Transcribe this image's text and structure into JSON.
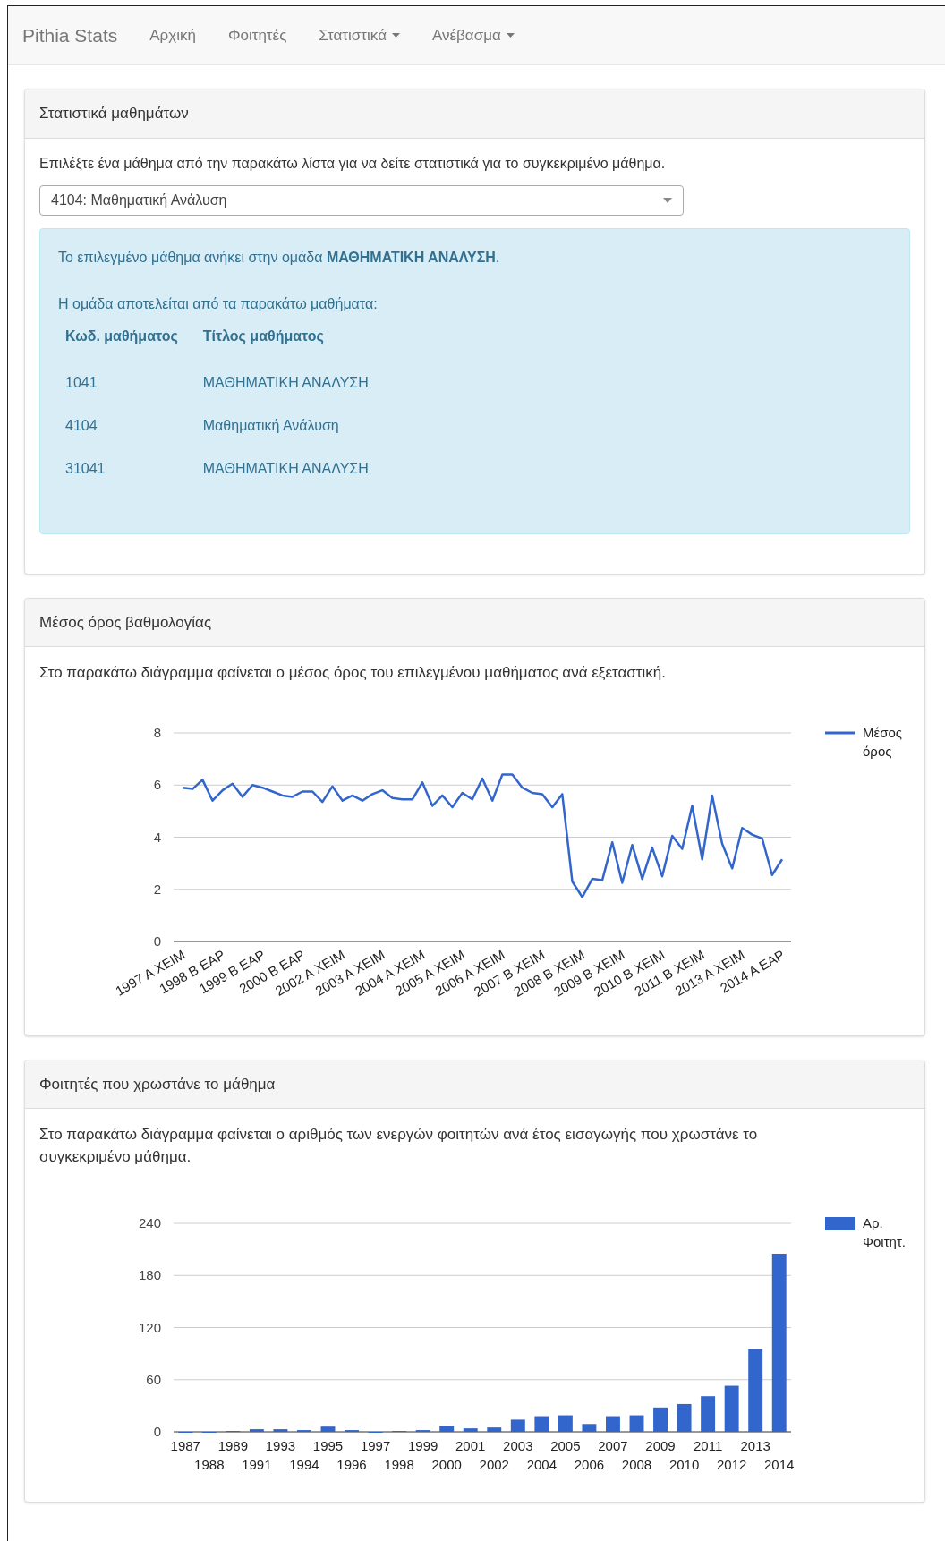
{
  "navbar": {
    "brand": "Pithia Stats",
    "items": [
      {
        "label": "Αρχική",
        "dropdown": false
      },
      {
        "label": "Φοιτητές",
        "dropdown": false
      },
      {
        "label": "Στατιστικά",
        "dropdown": true
      },
      {
        "label": "Ανέβασμα",
        "dropdown": true
      }
    ]
  },
  "course_panel": {
    "title": "Στατιστικά μαθημάτων",
    "intro": "Επιλέξτε ένα μάθημα από την παρακάτω λίστα για να δείτε στατιστικά για το συγκεκριμένο μάθημα.",
    "select": {
      "value": "4104: Μαθηματική Ανάλυση"
    },
    "info": {
      "group_text": "Το επιλεγμένο μάθημα ανήκει στην ομάδα **ΜΑΘΗΜΑΤΙΚΗ ΑΝΑΛΥΣΗ**.",
      "members_text": "Η ομάδα αποτελείται από τα παρακάτω μαθήματα:",
      "columns": [
        "Κωδ. μαθήματος",
        "Τίτλος μαθήματος"
      ],
      "rows": [
        [
          "1041",
          "ΜΑΘΗΜΑΤΙΚΗ ΑΝΑΛΥΣΗ"
        ],
        [
          "4104",
          "Μαθηματική Ανάλυση"
        ],
        [
          "31041",
          "ΜΑΘΗΜΑΤΙΚΗ ΑΝΑΛΥΣΗ"
        ]
      ]
    }
  },
  "average_panel": {
    "title": "Μέσος όρος βαθμολογίας",
    "text": "Στο παρακάτω διάγραμμα φαίνεται ο μέσος όρος του επιλεγμένου μαθήματος ανά εξεταστική.",
    "chart_data": {
      "type": "line",
      "ylim": [
        0,
        8
      ],
      "yticks": [
        0,
        2,
        4,
        6,
        8
      ],
      "grid": true,
      "categories": [
        "1997 A XEIM",
        null,
        null,
        null,
        "1998 B EAP",
        null,
        null,
        null,
        "1999 B EAP",
        null,
        null,
        null,
        "2000 B EAP",
        null,
        null,
        null,
        "2002 A XEIM",
        null,
        null,
        null,
        "2003 A XEIM",
        null,
        null,
        null,
        "2004 A XEIM",
        null,
        null,
        null,
        "2005 A XEIM",
        null,
        null,
        null,
        "2006 A XEIM",
        null,
        null,
        null,
        "2007 B XEIM",
        null,
        null,
        null,
        "2008 B XEIM",
        null,
        null,
        null,
        "2009 B XEIM",
        null,
        null,
        null,
        "2010 B XEIM",
        null,
        null,
        null,
        "2011 B XEIM",
        null,
        null,
        null,
        "2013 A XEIM",
        null,
        null,
        null,
        "2014 A EAP"
      ],
      "series": [
        {
          "name": "Μέσος όρος",
          "color": "#3366cc",
          "values": [
            5.9,
            5.85,
            6.2,
            5.4,
            5.8,
            6.05,
            5.55,
            6.0,
            5.9,
            5.75,
            5.6,
            5.55,
            5.75,
            5.75,
            5.35,
            5.95,
            5.4,
            5.6,
            5.4,
            5.65,
            5.8,
            5.5,
            5.45,
            5.45,
            6.1,
            5.2,
            5.6,
            5.15,
            5.7,
            5.45,
            6.25,
            5.4,
            6.4,
            6.4,
            5.9,
            5.7,
            5.65,
            5.15,
            5.65,
            2.3,
            1.7,
            2.4,
            2.35,
            3.8,
            2.25,
            3.7,
            2.4,
            3.6,
            2.5,
            4.05,
            3.55,
            5.2,
            3.15,
            5.6,
            3.75,
            2.8,
            4.35,
            4.1,
            3.95,
            2.55,
            3.15
          ]
        }
      ]
    }
  },
  "students_panel": {
    "title": "Φοιτητές που χρωστάνε το μάθημα",
    "text": "Στο παρακάτω διάγραμμα φαίνεται ο αριθμός των ενεργών φοιτητών ανά έτος εισαγωγής που χρωστάνε το συγκεκριμένο μάθημα.",
    "chart_data": {
      "type": "bar",
      "grid": true,
      "ylim": [
        0,
        240
      ],
      "yticks": [
        0,
        60,
        120,
        180,
        240
      ],
      "categories": [
        "1987",
        "1988",
        "1989",
        "1991",
        "1993",
        "1994",
        "1995",
        "1996",
        "1997",
        "1998",
        "1999",
        "2000",
        "2001",
        "2002",
        "2003",
        "2004",
        "2005",
        "2006",
        "2007",
        "2008",
        "2009",
        "2010",
        "2011",
        "2012",
        "2013",
        "2014"
      ],
      "series": [
        {
          "name": "Αρ. Φοιτητ.",
          "color": "#3366cc",
          "values": [
            0,
            0,
            1,
            3,
            3,
            2,
            6,
            2,
            0,
            1,
            2,
            7,
            4,
            5,
            14,
            18,
            19,
            9,
            18,
            19,
            28,
            32,
            41,
            53,
            95,
            205
          ]
        }
      ]
    }
  }
}
